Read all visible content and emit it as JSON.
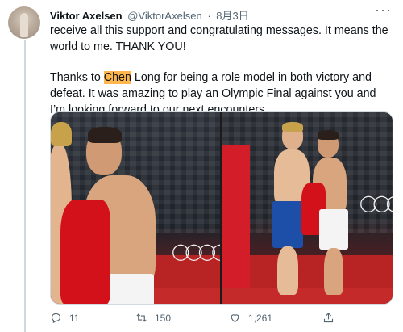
{
  "tweet": {
    "author_name": "Viktor Axelsen",
    "handle": "@ViktorAxelsen",
    "separator": "·",
    "date": "8月3日",
    "more_glyph": "···",
    "paragraph1": "receive all this support and congratulating messages. It means the world to me. THANK YOU!",
    "p2_before": "Thanks to ",
    "p2_highlight": "Chen",
    "p2_after": " Long for being a role model in both victory and defeat. It was amazing to play an Olympic Final against you and I’m looking forward to our next encounters.",
    "media_count": 2
  },
  "actions": {
    "reply_count": "11",
    "retweet_count": "150",
    "like_count": "1,261"
  },
  "icons": {
    "reply": "reply-icon",
    "retweet": "retweet-icon",
    "like": "heart-icon",
    "share": "share-icon",
    "more": "more-icon"
  },
  "colors": {
    "highlight": "#ffb74d",
    "secondary_text": "#536471",
    "thread_line": "#cfd9de"
  }
}
